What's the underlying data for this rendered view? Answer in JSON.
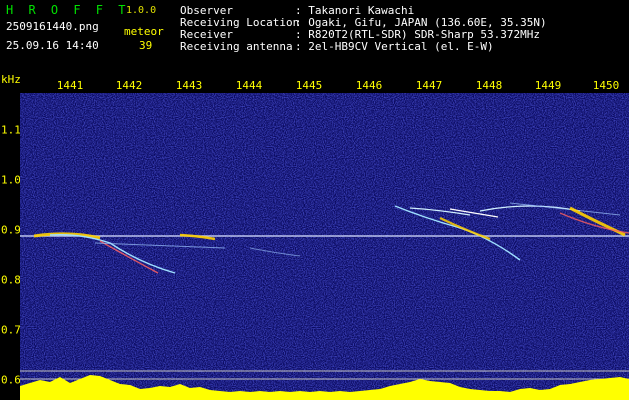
{
  "header": {
    "brand": "H R O F F T",
    "version": "1.0.0",
    "filename": "2509161440.png",
    "meteor_label": "meteor",
    "meteor_count": "39",
    "datetime": "25.09.16 14:40"
  },
  "info": [
    {
      "label": "Observer",
      "value": ": Takanori Kawachi"
    },
    {
      "label": "Receiving Location",
      "value": ": Ogaki, Gifu, JAPAN (136.60E, 35.35N)"
    },
    {
      "label": "Receiver",
      "value": ": R820T2(RTL-SDR) SDR-Sharp 53.372MHz"
    },
    {
      "label": "Receiving antenna",
      "value": ": 2el-HB9CV Vertical (el. E-W)"
    }
  ],
  "axis": {
    "y_unit": "kHz",
    "x_ticks": [
      "1441",
      "1442",
      "1443",
      "1444",
      "1445",
      "1446",
      "1447",
      "1448",
      "1449",
      "1450"
    ],
    "y_ticks": [
      "1.1",
      "1.0",
      "0.9",
      "0.8",
      "0.7",
      "0.6"
    ]
  },
  "colors": {
    "background": "#0a0a60",
    "carrier": "#d8e0ff",
    "echo": "#ffffff",
    "hot": "#ffd000",
    "level": "#ffff00",
    "axis_text": "#ffff00"
  }
}
